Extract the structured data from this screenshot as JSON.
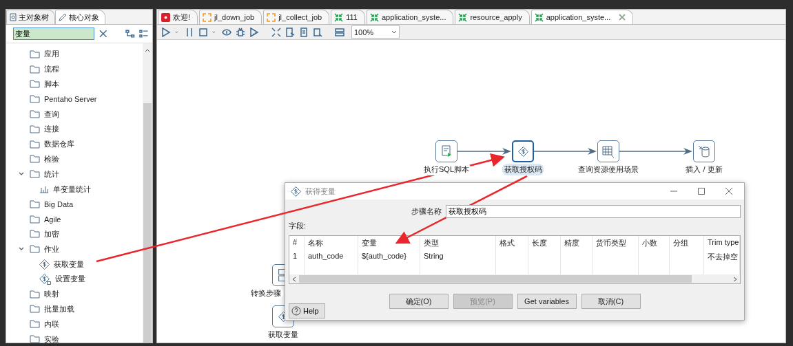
{
  "left_panel": {
    "tabs": [
      {
        "label": "主对象树",
        "selected": false
      },
      {
        "label": "核心对象",
        "selected": true
      }
    ],
    "search": {
      "value": "变量"
    },
    "tree": [
      {
        "label": "应用",
        "kind": "folder"
      },
      {
        "label": "流程",
        "kind": "folder"
      },
      {
        "label": "脚本",
        "kind": "folder"
      },
      {
        "label": "Pentaho Server",
        "kind": "folder"
      },
      {
        "label": "查询",
        "kind": "folder"
      },
      {
        "label": "连接",
        "kind": "folder"
      },
      {
        "label": "数据仓库",
        "kind": "folder"
      },
      {
        "label": "检验",
        "kind": "folder"
      },
      {
        "label": "统计",
        "kind": "folder",
        "expanded": true,
        "children": [
          {
            "label": "单变量统计",
            "kind": "stats"
          }
        ]
      },
      {
        "label": "Big Data",
        "kind": "folder"
      },
      {
        "label": "Agile",
        "kind": "folder"
      },
      {
        "label": "加密",
        "kind": "folder"
      },
      {
        "label": "作业",
        "kind": "folder",
        "expanded": true,
        "children": [
          {
            "label": "获取变量",
            "kind": "getvar"
          },
          {
            "label": "设置变量",
            "kind": "setvar"
          }
        ]
      },
      {
        "label": "映射",
        "kind": "folder"
      },
      {
        "label": "批量加载",
        "kind": "folder"
      },
      {
        "label": "内联",
        "kind": "folder"
      },
      {
        "label": "实验",
        "kind": "folder"
      }
    ]
  },
  "editor": {
    "tabs": [
      {
        "label": "欢迎!",
        "kind": "welcome",
        "selected": false
      },
      {
        "label": "jl_down_job",
        "kind": "job",
        "selected": false
      },
      {
        "label": "jl_collect_job",
        "kind": "job",
        "selected": false
      },
      {
        "label": "111",
        "kind": "trans",
        "selected": false
      },
      {
        "label": "application_syste...",
        "kind": "trans",
        "selected": false
      },
      {
        "label": "resource_apply",
        "kind": "trans",
        "selected": false
      },
      {
        "label": "application_syste...",
        "kind": "trans",
        "selected": true
      }
    ],
    "zoom": "100%",
    "steps": [
      {
        "label": "执行SQL脚本",
        "kind": "sql",
        "selected": false
      },
      {
        "label": "获取授权码",
        "kind": "getvar",
        "selected": true
      },
      {
        "label": "查询资源使用场景",
        "kind": "lookup",
        "selected": false
      },
      {
        "label": "插入 / 更新",
        "kind": "insert",
        "selected": false
      },
      {
        "label": "转换步骤",
        "kind": "mapping",
        "selected": false
      },
      {
        "label": "获取变量",
        "kind": "getvar",
        "selected": false
      }
    ]
  },
  "dialog": {
    "title": "获得变量",
    "step_name_label": "步骤名称",
    "step_name": "获取授权码",
    "fields_label": "字段:",
    "columns": [
      "#",
      "名称",
      "变量",
      "类型",
      "格式",
      "长度",
      "精度",
      "货币类型",
      "小数",
      "分组",
      "Trim type"
    ],
    "rows": [
      [
        "1",
        "auth_code",
        "${auth_code}",
        "String",
        "",
        "",
        "",
        "",
        "",
        "",
        "不去掉空"
      ]
    ],
    "buttons": [
      {
        "label": "确定(O)",
        "disabled": false
      },
      {
        "label": "预览(P)",
        "disabled": true
      },
      {
        "label": "Get variables",
        "disabled": false
      },
      {
        "label": "取消(C)",
        "disabled": false
      }
    ],
    "help": "Help"
  }
}
